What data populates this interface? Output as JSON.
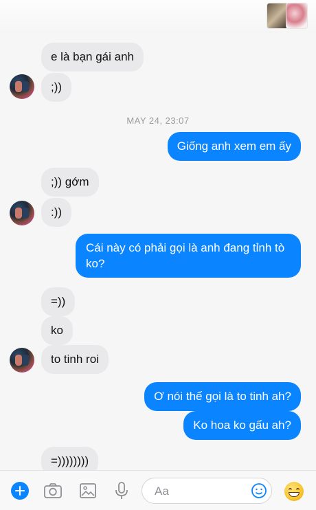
{
  "header": {
    "participant_thumbs": [
      "photo-thumb-1",
      "photo-thumb-2"
    ]
  },
  "messages": [
    {
      "dir": "in",
      "text": "e là bạn gái anh"
    },
    {
      "dir": "in",
      "text": ";))",
      "avatar": true
    },
    {
      "dir": "timestamp",
      "text": "MAY 24, 23:07"
    },
    {
      "dir": "out",
      "text": "Giống anh xem em ấy"
    },
    {
      "dir": "in",
      "text": ";)) gớm"
    },
    {
      "dir": "in",
      "text": ":))",
      "avatar": true
    },
    {
      "dir": "out",
      "text": "Cái này có phải gọi là anh đang tỉnh tò ko?"
    },
    {
      "dir": "in",
      "text": "=))"
    },
    {
      "dir": "in",
      "text": "ko"
    },
    {
      "dir": "in",
      "text": "to tinh roi",
      "avatar": true
    },
    {
      "dir": "out",
      "text": "Ơ nói thế gọi là to tinh ah?"
    },
    {
      "dir": "out",
      "text": "Ko hoa ko gấu ah?"
    },
    {
      "dir": "in",
      "text": "=))))))))"
    }
  ],
  "composer": {
    "placeholder": "Aa",
    "icons": [
      "plus-icon",
      "camera-icon",
      "image-icon",
      "microphone-icon",
      "emoji-icon",
      "grinning-emoji-icon"
    ]
  },
  "colors": {
    "outgoing_bubble": "#0b84ff",
    "incoming_bubble": "#e9e9ec",
    "background": "#f6f6f6"
  }
}
